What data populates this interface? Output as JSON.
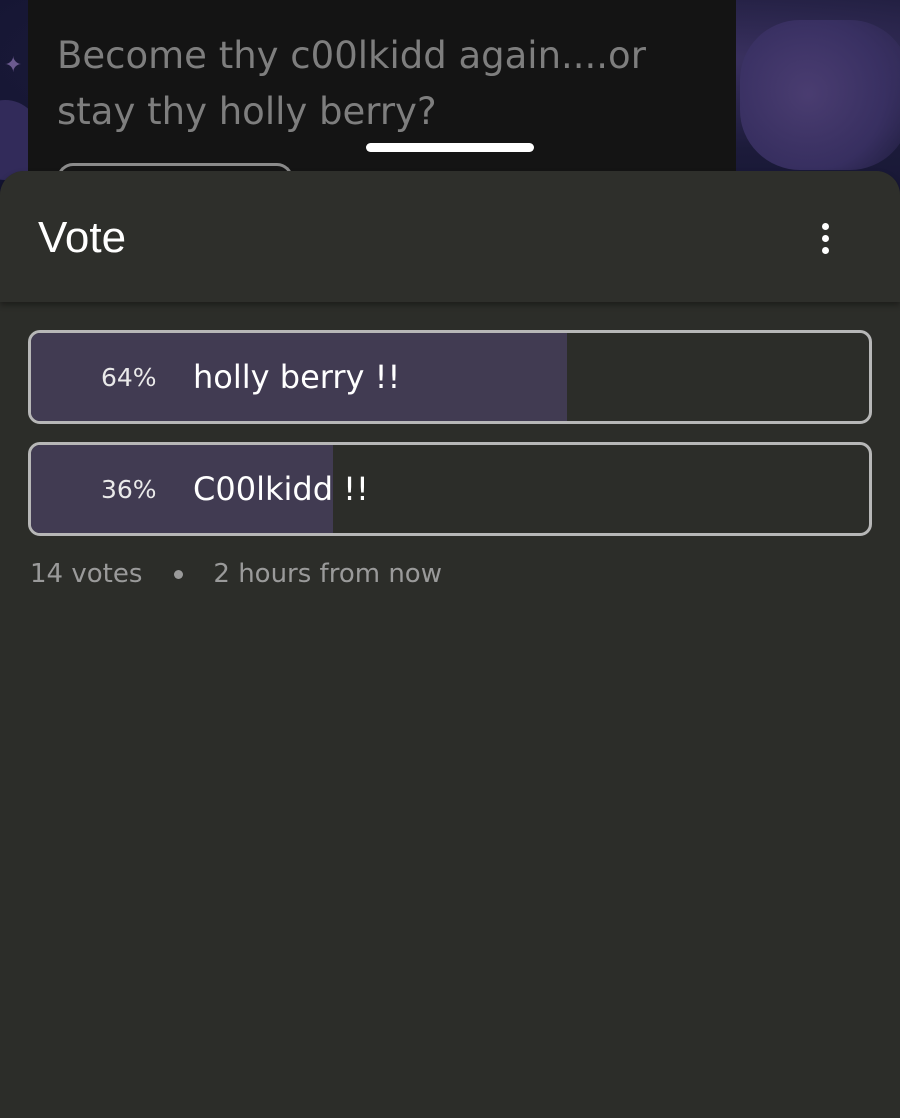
{
  "post": {
    "question": "Become thy c00lkidd again....or stay thy holly berry?"
  },
  "sheet": {
    "title": "Vote",
    "more_icon": "more-vert-icon"
  },
  "poll": {
    "options": [
      {
        "percent_label": "64%",
        "label": "holly berry !!",
        "share": 0.64
      },
      {
        "percent_label": "36%",
        "label": "C00lkidd !!",
        "share": 0.36
      }
    ],
    "votes_label": "14 votes",
    "time_label": "2 hours from now"
  },
  "colors": {
    "sheet_bg": "#2c2d29",
    "bar_fill": "#413b52",
    "outline": "#b7b7b7",
    "muted_text": "#9a9a9a"
  }
}
